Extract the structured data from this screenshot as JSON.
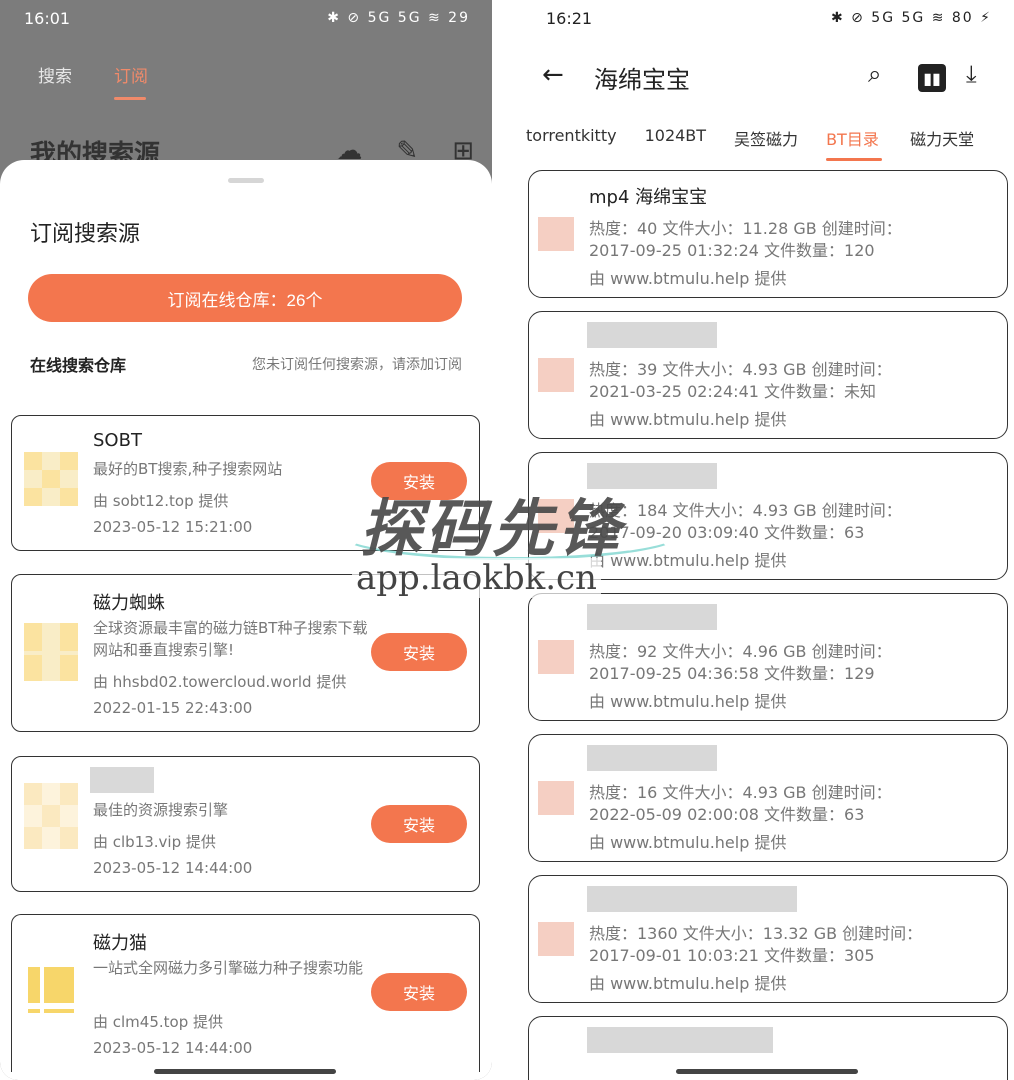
{
  "left": {
    "status": {
      "time": "16:01",
      "icons": "✱ ⊘ 5G 5G ≋ 29"
    },
    "bg_tabs": [
      "搜索",
      "订阅"
    ],
    "bg_title": "我的搜索源",
    "sheet": {
      "title": "订阅搜索源",
      "subscribe_button": "订阅在线仓库：26个",
      "section_label": "在线搜索仓库",
      "section_hint": "您未订阅任何搜索源，请添加订阅",
      "cards": [
        {
          "name": "SOBT",
          "desc": "最好的BT搜索,种子搜索网站",
          "by": "由 sobt12.top 提供",
          "date": "2023-05-12 15:21:00",
          "button": "安装"
        },
        {
          "name": "磁力蜘蛛",
          "desc": "全球资源最丰富的磁力链BT种子搜索下载网站和垂直搜索引擎!",
          "by": "由 hhsbd02.towercloud.world 提供",
          "date": "2022-01-15 22:43:00",
          "button": "安装"
        },
        {
          "name": "",
          "desc": "最佳的资源搜索引擎",
          "by": "由 clb13.vip 提供",
          "date": "2023-05-12 14:44:00",
          "button": "安装"
        },
        {
          "name": "磁力猫",
          "desc": "一站式全网磁力多引擎磁力种子搜索功能",
          "by": "由 clm45.top 提供",
          "date": "2023-05-12 14:44:00",
          "button": "安装"
        }
      ]
    }
  },
  "right": {
    "status": {
      "time": "16:21",
      "icons": "✱ ⊘ 5G 5G ≋ 80 ⚡"
    },
    "title": "海绵宝宝",
    "tabs": [
      "torrentkitty",
      "1024BT",
      "吴签磁力",
      "BT目录",
      "磁力天堂"
    ],
    "active_tab": 3,
    "results": [
      {
        "name": "mp4 海绵宝宝",
        "line1": "热度：40  文件大小：11.28 GB  创建时间：",
        "line2": "2017-09-25 01:32:24  文件数量：120",
        "src": "由 www.btmulu.help 提供"
      },
      {
        "name": "",
        "line1": "热度：39  文件大小：4.93 GB  创建时间：",
        "line2": "2021-03-25 02:24:41  文件数量：未知",
        "src": "由 www.btmulu.help 提供"
      },
      {
        "name": "",
        "line1": "热度：184  文件大小：4.93 GB  创建时间：",
        "line2": "2017-09-20 03:09:40  文件数量：63",
        "src": "由 www.btmulu.help 提供"
      },
      {
        "name": "",
        "line1": "热度：92  文件大小：4.96 GB  创建时间：",
        "line2": "2017-09-25 04:36:58  文件数量：129",
        "src": "由 www.btmulu.help 提供"
      },
      {
        "name": "",
        "line1": "热度：16  文件大小：4.93 GB  创建时间：",
        "line2": "2022-05-09 02:00:08  文件数量：63",
        "src": "由 www.btmulu.help 提供"
      },
      {
        "name": "",
        "line1": "热度：1360  文件大小：13.32 GB  创建时间：",
        "line2": "2017-09-01 10:03:21  文件数量：305",
        "src": "由 www.btmulu.help 提供"
      }
    ]
  },
  "watermark": {
    "text": "探码先锋",
    "url": "app.laokbk.cn"
  }
}
